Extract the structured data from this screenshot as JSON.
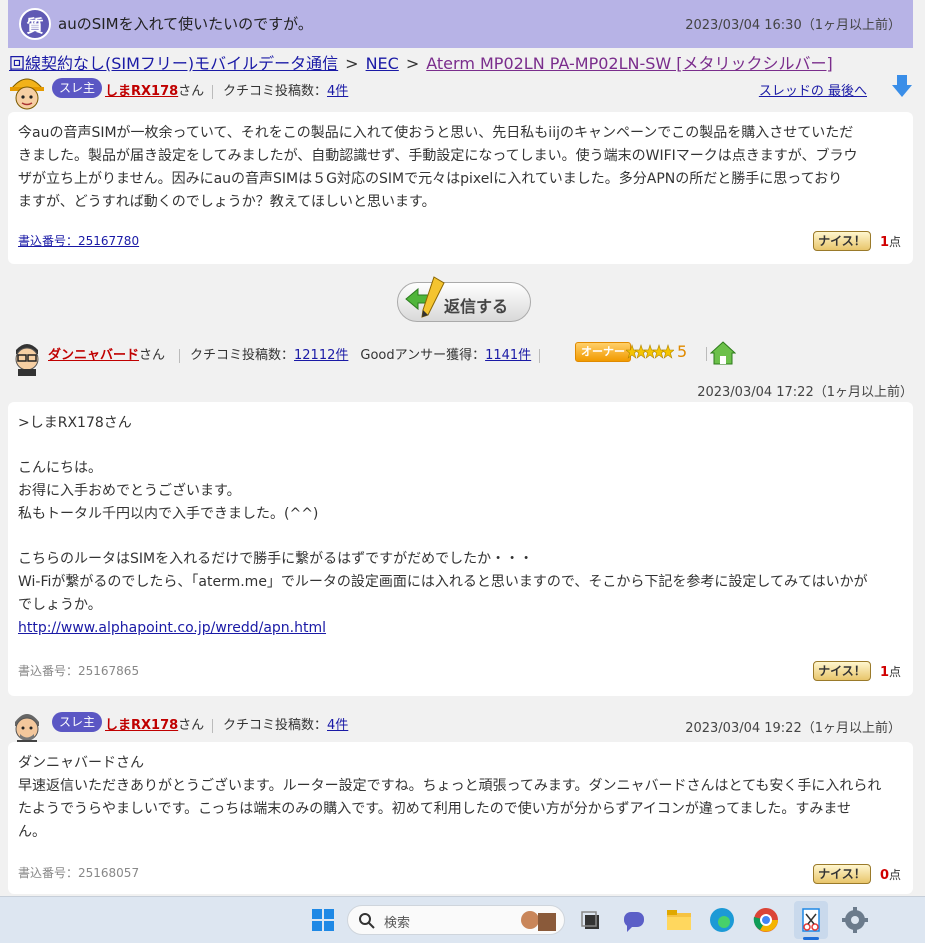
{
  "question": {
    "badge": "質",
    "title": "auのSIMを入れて使いたいのですが。",
    "datetime": "2023/03/04 16:30（1ヶ月以上前）"
  },
  "breadcrumb": {
    "items": [
      "回線契約なし(SIMフリー)モバイルデータ通信",
      "NEC",
      "Aterm MP02LN PA-MP02LN-SW [メタリックシルバー]"
    ],
    "separator": ">"
  },
  "thread": {
    "to_last": "スレッドの 最後へ",
    "reply_button": "返信する"
  },
  "posts": [
    {
      "owner_badge": "スレ主",
      "user": "しまRX178",
      "san": "さん",
      "kuchikomi_label": "クチコミ投稿数：",
      "kuchikomi_count": "4件",
      "lines": [
        "今auの音声SIMが一枚余っていて、それをこの製品に入れて使おうと思い、先日私もiijのキャンペーンでこの製品を購入させていただ",
        "きました。製品が届き設定をしてみましたが、自動認識せず、手動設定になってしまい。使う端末のWIFIマークは点きますが、ブラウ",
        "ザが立ち上がりません。因みにauの音声SIMは５G対応のSIMで元々はpixelに入れていました。多分APNの所だと勝手に思っており",
        "ますが、どうすれば動くのでしょうか？教えてほしいと思います。"
      ],
      "post_no": "書込番号：25167780",
      "nice": "ナイス！",
      "points": "1",
      "points_unit": "点"
    },
    {
      "user": "ダンニャバード",
      "san": "さん",
      "kuchikomi_label": "クチコミ投稿数：",
      "kuchikomi_count": "12112件",
      "good_label": "Goodアンサー獲得：",
      "good_count": "1141件",
      "owner_label": "オーナー",
      "stars": "5",
      "datetime": "2023/03/04 17:22（1ヶ月以上前）",
      "lines": [
        ">しまRX178さん",
        "",
        "こんにちは。",
        "お得に入手おめでとうございます。",
        "私もトータル千円以内で入手できました。(^^)",
        "",
        "こちらのルータはSIMを入れるだけで勝手に繋がるはずですがだめでしたか・・・",
        "Wi-Fiが繋がるのでしたら、「aterm.me」でルータの設定画面には入れると思いますので、そこから下記を参考に設定してみてはいかが",
        "でしょうか。"
      ],
      "link": "http://www.alphapoint.co.jp/wredd/apn.html",
      "post_no": "書込番号：25167865",
      "nice": "ナイス！",
      "points": "1",
      "points_unit": "点"
    },
    {
      "owner_badge": "スレ主",
      "user": "しまRX178",
      "san": "さん",
      "kuchikomi_label": "クチコミ投稿数：",
      "kuchikomi_count": "4件",
      "datetime": "2023/03/04 19:22（1ヶ月以上前）",
      "lines": [
        "ダンニャバードさん",
        "早速返信いただきありがとうございます。ルーター設定ですね。ちょっと頑張ってみます。ダンニャバードさんはとても安く手に入れられ",
        "たようでうらやましいです。こっちは端末のみの購入です。初めて利用したので使い方が分からずアイコンが違ってました。すみませ",
        "ん。"
      ],
      "post_no": "書込番号：25168057",
      "nice": "ナイス！",
      "points": "0",
      "points_unit": "点"
    }
  ],
  "taskbar": {
    "search_placeholder": "検索"
  }
}
